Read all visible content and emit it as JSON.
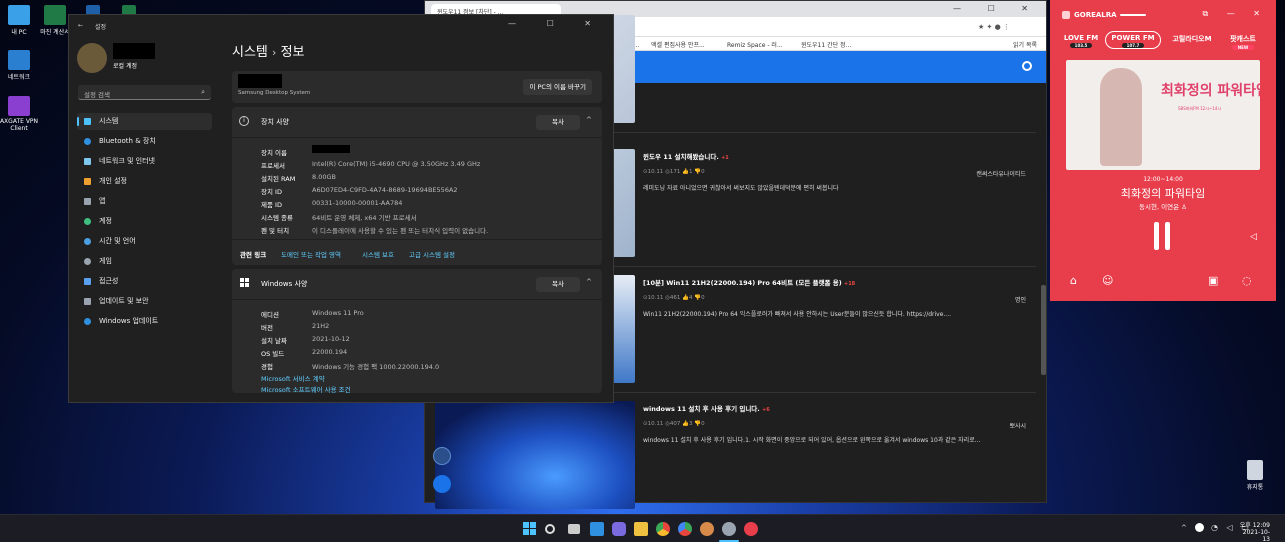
{
  "desktop": {
    "icons": [
      {
        "label": "내 PC"
      },
      {
        "label": "마진 계산서"
      },
      {
        "label": "네트워크"
      },
      {
        "label": "AXGATE VPN Client"
      },
      {
        "label": "휴지통"
      }
    ]
  },
  "browser": {
    "tab_title": "윈도우11 정보 [차단] - ...",
    "bookmarks": [
      "(바른녹...",
      "액셀 편집사용 안프...",
      "Remiz Space - 러...",
      "윈도우11 간단 정..."
    ],
    "bookmarks_right": "읽기 목록",
    "posts": [
      {
        "title": "윈도우 11 설치해봤습니다.",
        "badge": "+1",
        "meta": "⊙10.11   ◎171   👍1   👎0",
        "author": "캔써스타유나이티드",
        "desc": "레미도닝 자료 아니었으면 귀찮아서 써보지도 않았을텐데덕분에 편히 써봅니다"
      },
      {
        "title": "[10분] Win11 21H2(22000.194) Pro 64비트 (모든 플랫폼 용)",
        "badge": "+18",
        "meta": "⊙10.11   ◎461   👍4   👎0",
        "author": "명인",
        "desc": "Win11 21H2(22000.194) Pro 64 익스플로러가 빠져서 사용 안하시는 User분들이 많으신듯 합니다. https://drive...."
      },
      {
        "title": "windows 11 설치 후 사용 후기 입니다.",
        "badge": "+6",
        "meta": "⊙10.11   ◎407   👍3   👎0",
        "author": "뽀사시",
        "desc": "windows 11 설치 후 사용 후기 입니다.1. 시작 화면이 중앙으로 되어 있어, 옵션으로 왼쪽으로 옮겨서 windows 10과 같은 자리로..."
      }
    ]
  },
  "settings": {
    "window_title": "설정",
    "account_label": "로컬 계정",
    "search_placeholder": "설정 검색",
    "breadcrumb_parent": "시스템",
    "breadcrumb_sep": "›",
    "breadcrumb_current": "정보",
    "device_model": "Samsung Desktop System",
    "rename_button": "이 PC의 이름 바꾸기",
    "nav": [
      {
        "label": "시스템",
        "color": "#4cc2ff"
      },
      {
        "label": "Bluetooth & 장치",
        "color": "#2f8fe0"
      },
      {
        "label": "네트워크 및 인터넷",
        "color": "#7ec8f0"
      },
      {
        "label": "개인 설정",
        "color": "#f0a030"
      },
      {
        "label": "앱",
        "color": "#9aa4b0"
      },
      {
        "label": "계정",
        "color": "#3fbf7f"
      },
      {
        "label": "시간 및 언어",
        "color": "#4aa0e0"
      },
      {
        "label": "게임",
        "color": "#9aa4b0"
      },
      {
        "label": "접근성",
        "color": "#5aa0f0"
      },
      {
        "label": "업데이트 및 보안",
        "color": "#9aa4b0"
      },
      {
        "label": "Windows 업데이트",
        "color": "#2f8fe0"
      }
    ],
    "device_specs": {
      "title": "장치 사양",
      "copy": "복사",
      "rows": [
        {
          "k": "장치 이름",
          "v": ""
        },
        {
          "k": "프로세서",
          "v": "Intel(R) Core(TM) i5-4690 CPU @ 3.50GHz   3.49 GHz"
        },
        {
          "k": "설치된 RAM",
          "v": "8.00GB"
        },
        {
          "k": "장치 ID",
          "v": "A6D07ED4-C9FD-4A74-8689-19694BE556A2"
        },
        {
          "k": "제품 ID",
          "v": "00331-10000-00001-AA784"
        },
        {
          "k": "시스템 종류",
          "v": "64비트 운영 체제, x64 기반 프로세서"
        },
        {
          "k": "펜 및 터치",
          "v": "이 디스플레이에 사용할 수 있는 펜 또는 터치식 입력이 없습니다."
        }
      ]
    },
    "related": {
      "label": "관련 링크",
      "links": [
        "도메인 또는 작업 영역",
        "시스템 보호",
        "고급 시스템 설정"
      ]
    },
    "windows_specs": {
      "title": "Windows 사양",
      "copy": "복사",
      "rows": [
        {
          "k": "에디션",
          "v": "Windows 11 Pro"
        },
        {
          "k": "버전",
          "v": "21H2"
        },
        {
          "k": "설치 날짜",
          "v": "2021-10-12"
        },
        {
          "k": "OS 빌드",
          "v": "22000.194"
        },
        {
          "k": "경험",
          "v": "Windows 기능 경험 팩 1000.22000.194.0"
        }
      ],
      "links": [
        "Microsoft 서비스 계약",
        "Microsoft 소프트웨어 사용 조건"
      ]
    }
  },
  "radio": {
    "app_name": "GOREALRA",
    "channels": [
      {
        "name": "LOVE FM",
        "freq": "103.5"
      },
      {
        "name": "POWER FM",
        "freq": "107.7"
      },
      {
        "name": "고릴라디오M",
        "freq": ""
      },
      {
        "name": "팟캐스트",
        "freq": "NEW"
      }
    ],
    "program_logo": "최화정의 파워타임",
    "program_sub": "SBS파워FM 12시~14시",
    "time": "12:00~14:00",
    "program": "최화정의 파워타임",
    "hosts": "동시현, 이연윤"
  },
  "taskbar": {
    "time": "오후 12:09",
    "date": "2021-10-13"
  }
}
